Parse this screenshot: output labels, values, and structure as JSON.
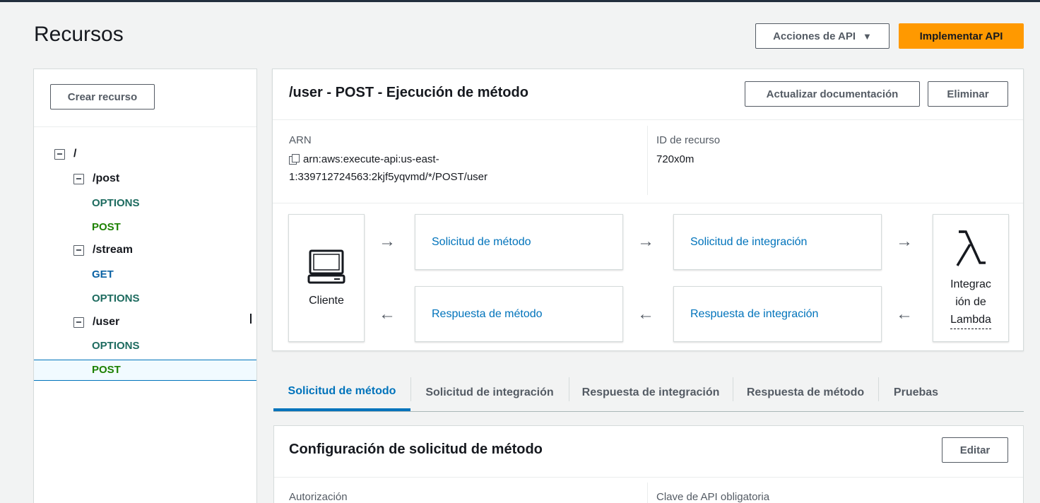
{
  "page": {
    "title": "Recursos"
  },
  "header": {
    "api_actions_label": "Acciones de API",
    "deploy_label": "Implementar API"
  },
  "sidebar": {
    "create_resource_label": "Crear recurso",
    "tree": [
      {
        "label": "/",
        "type": "resource"
      },
      {
        "label": "/post",
        "type": "resource"
      },
      {
        "label": "OPTIONS",
        "type": "method"
      },
      {
        "label": "POST",
        "type": "method"
      },
      {
        "label": "/stream",
        "type": "resource"
      },
      {
        "label": "GET",
        "type": "method"
      },
      {
        "label": "OPTIONS",
        "type": "method"
      },
      {
        "label": "/user",
        "type": "resource"
      },
      {
        "label": "OPTIONS",
        "type": "method"
      },
      {
        "label": "POST",
        "type": "method",
        "selected": true
      }
    ]
  },
  "panel": {
    "title": "/user - POST - Ejecución de método",
    "update_docs_label": "Actualizar documentación",
    "delete_label": "Eliminar",
    "arn_label": "ARN",
    "arn_line1": "arn:aws:execute-api:us-east-",
    "arn_line2": "1:339712724563:2kjf5yqvmd/*/POST/user",
    "resource_id_label": "ID de recurso",
    "resource_id_value": "720x0m"
  },
  "flow": {
    "client_label": "Cliente",
    "method_request": "Solicitud de método",
    "integration_request": "Solicitud de integración",
    "method_response": "Respuesta de método",
    "integration_response": "Respuesta de integración",
    "lambda_line1": "Integrac",
    "lambda_line2": "ión de",
    "lambda_line3": "Lambda"
  },
  "tabs": [
    {
      "label": "Solicitud de método",
      "active": true
    },
    {
      "label": "Solicitud de integración"
    },
    {
      "label": "Respuesta de integración"
    },
    {
      "label": "Respuesta de método"
    },
    {
      "label": "Pruebas"
    }
  ],
  "config": {
    "title": "Configuración de solicitud de método",
    "edit_label": "Editar",
    "authorization_label": "Autorización",
    "api_key_required_label": "Clave de API obligatoria"
  },
  "colors": {
    "primary": "#ff9900",
    "link": "#0073bb",
    "post_method": "#1d8102",
    "options_method": "#1d6b5f",
    "get_method": "#0b62a4"
  }
}
